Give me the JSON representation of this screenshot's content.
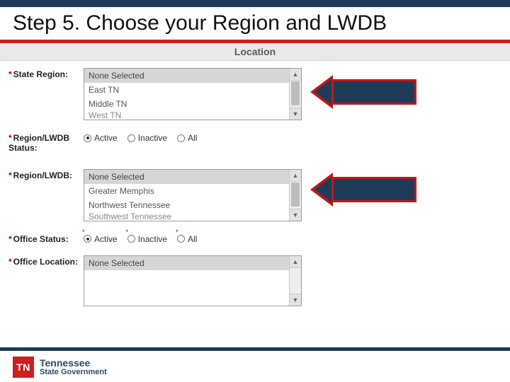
{
  "title": "Step 5.  Choose your Region and LWDB",
  "section_header": "Location",
  "state_region": {
    "label": "State Region:",
    "options": [
      "None Selected",
      "East TN",
      "Middle TN",
      "West TN"
    ],
    "selected_index": 0
  },
  "region_lwdb_status": {
    "label": "Region/LWDB Status:",
    "options": [
      "Active",
      "Inactive",
      "All"
    ],
    "selected": "Active"
  },
  "region_lwdb": {
    "label": "Region/LWDB:",
    "options": [
      "None Selected",
      "Greater Memphis",
      "Northwest Tennessee",
      "Southwest Tennessee"
    ],
    "selected_index": 0
  },
  "office_status": {
    "label": "Office Status:",
    "options": [
      "Active",
      "Inactive",
      "All"
    ],
    "selected": "Active"
  },
  "office_location": {
    "label": "Office Location:",
    "options": [
      "None Selected"
    ],
    "selected_index": 0
  },
  "footer": {
    "badge": "TN",
    "line1": "Tennessee",
    "line2": "State Government"
  }
}
